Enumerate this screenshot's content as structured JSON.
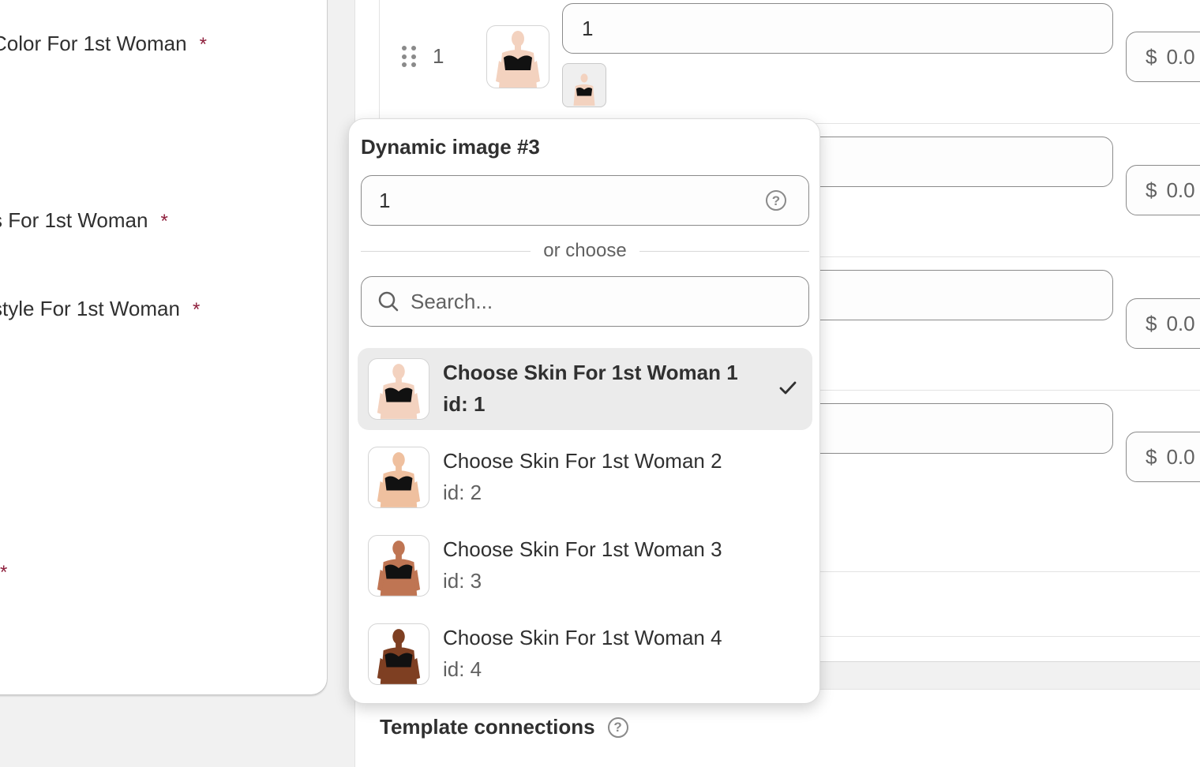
{
  "left_form": {
    "labels": [
      "Color For 1st Woman",
      "s For 1st Woman",
      "style For 1st Woman"
    ],
    "required_mark": "*"
  },
  "table": {
    "first_row": {
      "index": "1",
      "value": "1"
    },
    "currency": "$",
    "price_prefix": "0.0"
  },
  "popover": {
    "title": "Dynamic image #3",
    "input_value": "1",
    "divider_text": "or choose",
    "search_placeholder": "Search...",
    "options": [
      {
        "label": "Choose Skin For 1st Woman 1",
        "id": "id: 1",
        "selected": true,
        "skin": "#f3d2bf"
      },
      {
        "label": "Choose Skin For 1st Woman 2",
        "id": "id: 2",
        "selected": false,
        "skin": "#efc09f"
      },
      {
        "label": "Choose Skin For 1st Woman 3",
        "id": "id: 3",
        "selected": false,
        "skin": "#bf7553"
      },
      {
        "label": "Choose Skin For 1st Woman 4",
        "id": "id: 4",
        "selected": false,
        "skin": "#7e3f22"
      }
    ]
  },
  "footer": {
    "section_title": "Template connections"
  },
  "colors": {
    "required": "#8e1f3c",
    "selected_bg": "#ebebeb",
    "top_skin": "#f3d2bf"
  }
}
